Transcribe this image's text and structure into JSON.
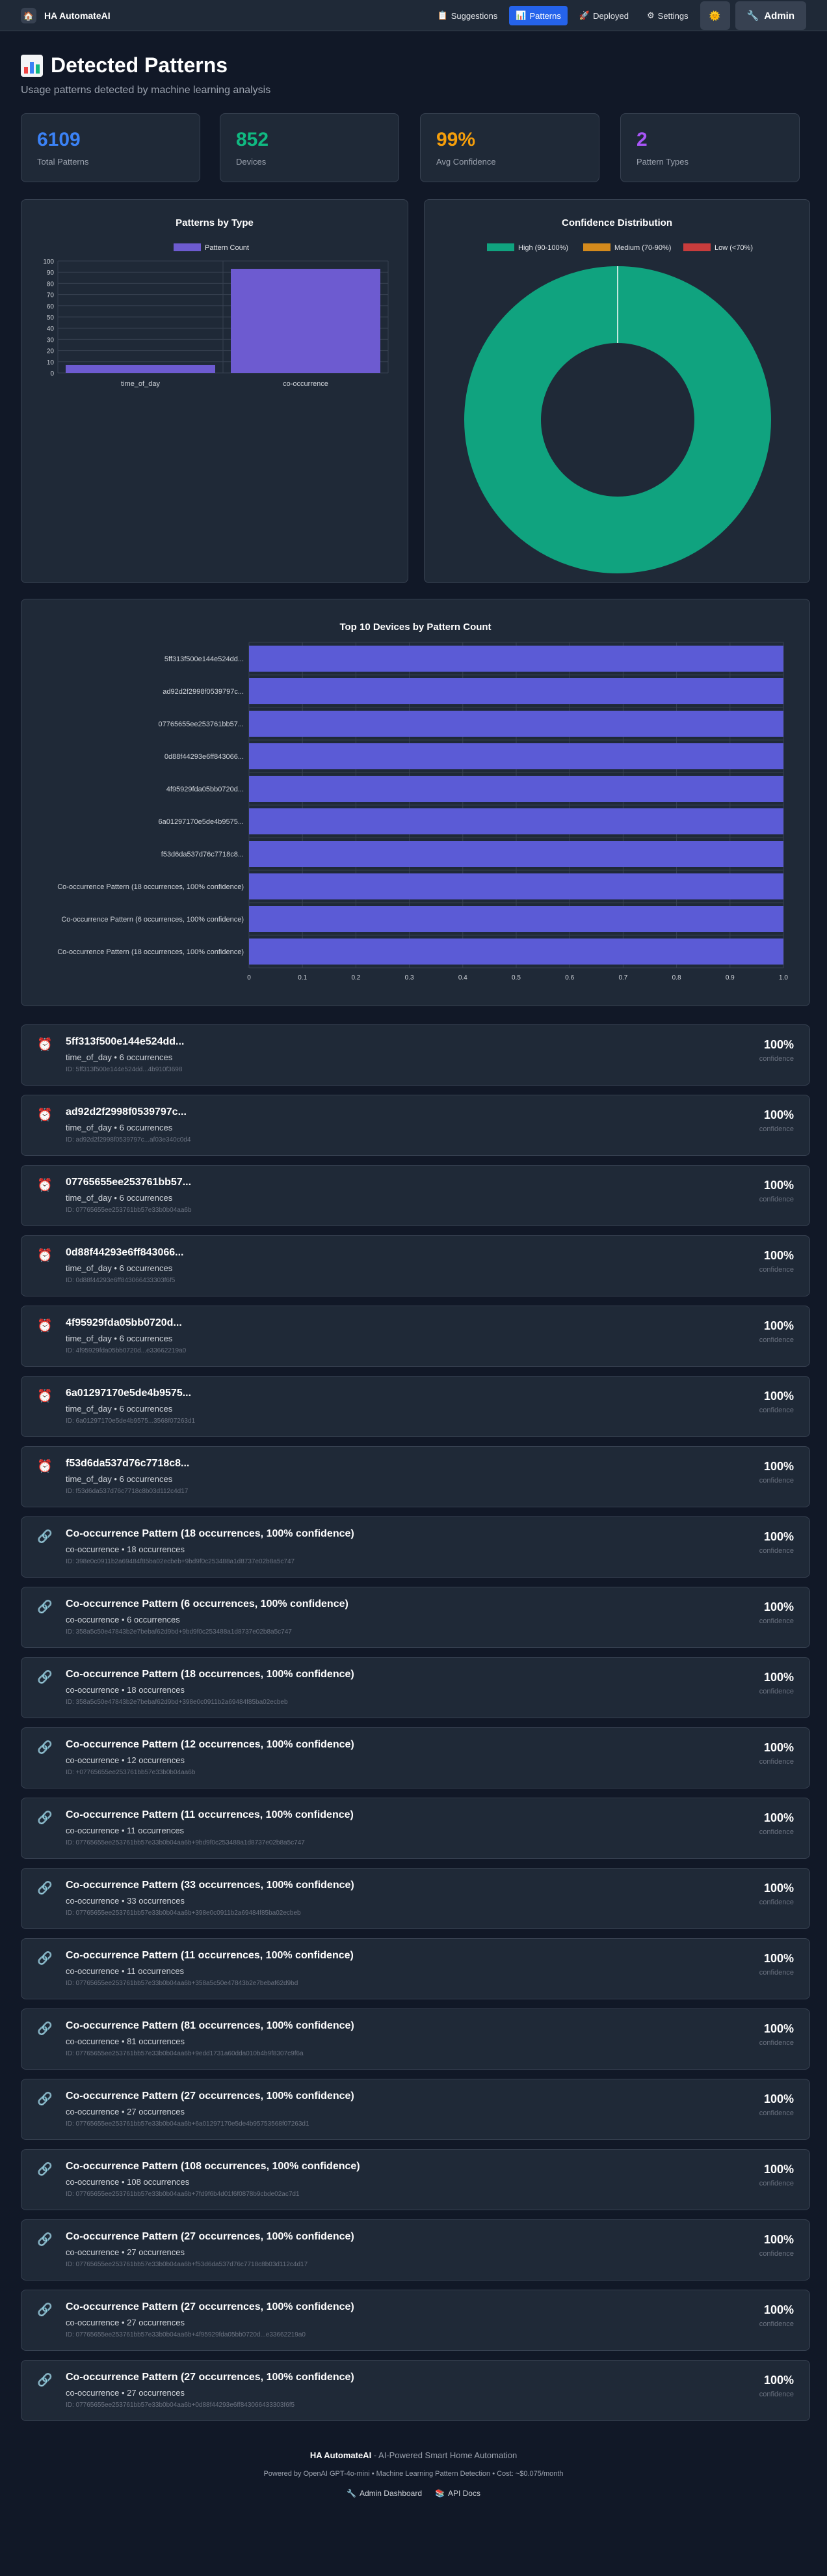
{
  "app": {
    "title": "HA AutomateAI"
  },
  "nav": {
    "items": [
      {
        "label": "Suggestions",
        "icon": "clipboard-icon"
      },
      {
        "label": "Patterns",
        "icon": "bar-chart-icon"
      },
      {
        "label": "Deployed",
        "icon": "rocket-icon"
      },
      {
        "label": "Settings",
        "icon": "gear-icon"
      }
    ],
    "active": "Patterns",
    "theme_icon": "sun-icon",
    "admin_label": "Admin"
  },
  "page": {
    "title": "Detected Patterns",
    "subtitle": "Usage patterns detected by machine learning analysis"
  },
  "stats": [
    {
      "value": "6109",
      "label": "Total Patterns",
      "color": "#3b82f6"
    },
    {
      "value": "852",
      "label": "Devices",
      "color": "#10b981"
    },
    {
      "value": "99%",
      "label": "Avg Confidence",
      "color": "#f59e0b"
    },
    {
      "value": "2",
      "label": "Pattern Types",
      "color": "#a855f7"
    }
  ],
  "chart_data": [
    {
      "type": "bar",
      "title": "Patterns by Type",
      "categories": [
        "time_of_day",
        "co-occurrence"
      ],
      "series": [
        {
          "name": "Pattern Count",
          "values": [
            7,
            93
          ],
          "color": "#6d5bd0"
        }
      ],
      "ylim": [
        0,
        100
      ],
      "yticks": [
        0,
        10,
        20,
        30,
        40,
        50,
        60,
        70,
        80,
        90,
        100
      ],
      "legend": "top",
      "grid": true
    },
    {
      "type": "pie",
      "title": "Confidence Distribution",
      "donut": true,
      "labels": [
        "High (90-100%)",
        "Medium (70-90%)",
        "Low (<70%)"
      ],
      "values": [
        100,
        0,
        0
      ],
      "colors": [
        "#10a37f",
        "#d48a1c",
        "#c83c3c"
      ],
      "legend": "top"
    },
    {
      "type": "bar",
      "orientation": "horizontal",
      "title": "Top 10 Devices by Pattern Count",
      "categories": [
        "5ff313f500e144e524dd...",
        "ad92d2f2998f0539797c...",
        "07765655ee253761bb57...",
        "0d88f44293e6ff843066...",
        "4f95929fda05bb0720d...",
        "6a01297170e5de4b9575...",
        "f53d6da537d76c7718c8...",
        "Co-occurrence Pattern (18 occurrences, 100% confidence)",
        "Co-occurrence Pattern (6 occurrences, 100% confidence)",
        "Co-occurrence Pattern (18 occurrences, 100% confidence)"
      ],
      "values": [
        1,
        1,
        1,
        1,
        1,
        1,
        1,
        1,
        1,
        1
      ],
      "xlim": [
        0,
        1
      ],
      "xticks": [
        "0",
        "0.1",
        "0.2",
        "0.3",
        "0.4",
        "0.5",
        "0.6",
        "0.7",
        "0.8",
        "0.9",
        "1.0"
      ],
      "color": "#5b5bd6",
      "grid": true
    }
  ],
  "patterns": {
    "confidence_label": "confidence",
    "items": [
      {
        "icon": "alarm-clock-icon",
        "name": "5ff313f500e144e524dd...",
        "meta": "time_of_day • 6 occurrences",
        "id": "ID: 5ff313f500e144e524dd...4b910f3698",
        "conf": "100%"
      },
      {
        "icon": "alarm-clock-icon",
        "name": "ad92d2f2998f0539797c...",
        "meta": "time_of_day • 6 occurrences",
        "id": "ID: ad92d2f2998f0539797c...af03e340c0d4",
        "conf": "100%"
      },
      {
        "icon": "alarm-clock-icon",
        "name": "07765655ee253761bb57...",
        "meta": "time_of_day • 6 occurrences",
        "id": "ID: 07765655ee253761bb57e33b0b04aa6b",
        "conf": "100%"
      },
      {
        "icon": "alarm-clock-icon",
        "name": "0d88f44293e6ff843066...",
        "meta": "time_of_day • 6 occurrences",
        "id": "ID: 0d88f44293e6ff843066433303f6f5",
        "conf": "100%"
      },
      {
        "icon": "alarm-clock-icon",
        "name": "4f95929fda05bb0720d...",
        "meta": "time_of_day • 6 occurrences",
        "id": "ID: 4f95929fda05bb0720d...e33662219a0",
        "conf": "100%"
      },
      {
        "icon": "alarm-clock-icon",
        "name": "6a01297170e5de4b9575...",
        "meta": "time_of_day • 6 occurrences",
        "id": "ID: 6a01297170e5de4b9575...3568f07263d1",
        "conf": "100%"
      },
      {
        "icon": "alarm-clock-icon",
        "name": "f53d6da537d76c7718c8...",
        "meta": "time_of_day • 6 occurrences",
        "id": "ID: f53d6da537d76c7718c8b03d112c4d17",
        "conf": "100%"
      },
      {
        "icon": "link-icon",
        "name": "Co-occurrence Pattern (18 occurrences, 100% confidence)",
        "meta": "co-occurrence • 18 occurrences",
        "id": "ID: 398e0c0911b2a69484f85ba02ecbeb+9bd9f0c253488a1d8737e02b8a5c747",
        "conf": "100%"
      },
      {
        "icon": "link-icon",
        "name": "Co-occurrence Pattern (6 occurrences, 100% confidence)",
        "meta": "co-occurrence • 6 occurrences",
        "id": "ID: 358a5c50e47843b2e7bebaf62d9bd+9bd9f0c253488a1d8737e02b8a5c747",
        "conf": "100%"
      },
      {
        "icon": "link-icon",
        "name": "Co-occurrence Pattern (18 occurrences, 100% confidence)",
        "meta": "co-occurrence • 18 occurrences",
        "id": "ID: 358a5c50e47843b2e7bebaf62d9bd+398e0c0911b2a69484f85ba02ecbeb",
        "conf": "100%"
      },
      {
        "icon": "link-icon",
        "name": "Co-occurrence Pattern (12 occurrences, 100% confidence)",
        "meta": "co-occurrence • 12 occurrences",
        "id": "ID: +07765655ee253761bb57e33b0b04aa6b",
        "conf": "100%"
      },
      {
        "icon": "link-icon",
        "name": "Co-occurrence Pattern (11 occurrences, 100% confidence)",
        "meta": "co-occurrence • 11 occurrences",
        "id": "ID: 07765655ee253761bb57e33b0b04aa6b+9bd9f0c253488a1d8737e02b8a5c747",
        "conf": "100%"
      },
      {
        "icon": "link-icon",
        "name": "Co-occurrence Pattern (33 occurrences, 100% confidence)",
        "meta": "co-occurrence • 33 occurrences",
        "id": "ID: 07765655ee253761bb57e33b0b04aa6b+398e0c0911b2a69484f85ba02ecbeb",
        "conf": "100%"
      },
      {
        "icon": "link-icon",
        "name": "Co-occurrence Pattern (11 occurrences, 100% confidence)",
        "meta": "co-occurrence • 11 occurrences",
        "id": "ID: 07765655ee253761bb57e33b0b04aa6b+358a5c50e47843b2e7bebaf62d9bd",
        "conf": "100%"
      },
      {
        "icon": "link-icon",
        "name": "Co-occurrence Pattern (81 occurrences, 100% confidence)",
        "meta": "co-occurrence • 81 occurrences",
        "id": "ID: 07765655ee253761bb57e33b0b04aa6b+9edd1731a60dda010b4b9f8307c9f6a",
        "conf": "100%"
      },
      {
        "icon": "link-icon",
        "name": "Co-occurrence Pattern (27 occurrences, 100% confidence)",
        "meta": "co-occurrence • 27 occurrences",
        "id": "ID: 07765655ee253761bb57e33b0b04aa6b+6a01297170e5de4b95753568f07263d1",
        "conf": "100%"
      },
      {
        "icon": "link-icon",
        "name": "Co-occurrence Pattern (108 occurrences, 100% confidence)",
        "meta": "co-occurrence • 108 occurrences",
        "id": "ID: 07765655ee253761bb57e33b0b04aa6b+7fd9f6b4d01f6f0878b9cbde02ac7d1",
        "conf": "100%"
      },
      {
        "icon": "link-icon",
        "name": "Co-occurrence Pattern (27 occurrences, 100% confidence)",
        "meta": "co-occurrence • 27 occurrences",
        "id": "ID: 07765655ee253761bb57e33b0b04aa6b+f53d6da537d76c7718c8b03d112c4d17",
        "conf": "100%"
      },
      {
        "icon": "link-icon",
        "name": "Co-occurrence Pattern (27 occurrences, 100% confidence)",
        "meta": "co-occurrence • 27 occurrences",
        "id": "ID: 07765655ee253761bb57e33b0b04aa6b+4f95929fda05bb0720d...e33662219a0",
        "conf": "100%"
      },
      {
        "icon": "link-icon",
        "name": "Co-occurrence Pattern (27 occurrences, 100% confidence)",
        "meta": "co-occurrence • 27 occurrences",
        "id": "ID: 07765655ee253761bb57e33b0b04aa6b+0d88f44293e6ff843066433303f6f5",
        "conf": "100%"
      }
    ]
  },
  "footer": {
    "title": "HA AutomateAI",
    "tagline": " - AI-Powered Smart Home Automation",
    "powered": "Powered by OpenAI GPT-4o-mini • Machine Learning Pattern Detection • Cost: ~$0.075/month",
    "links": [
      {
        "label": "Admin Dashboard",
        "icon": "wrench-icon"
      },
      {
        "label": "API Docs",
        "icon": "books-icon"
      }
    ]
  }
}
